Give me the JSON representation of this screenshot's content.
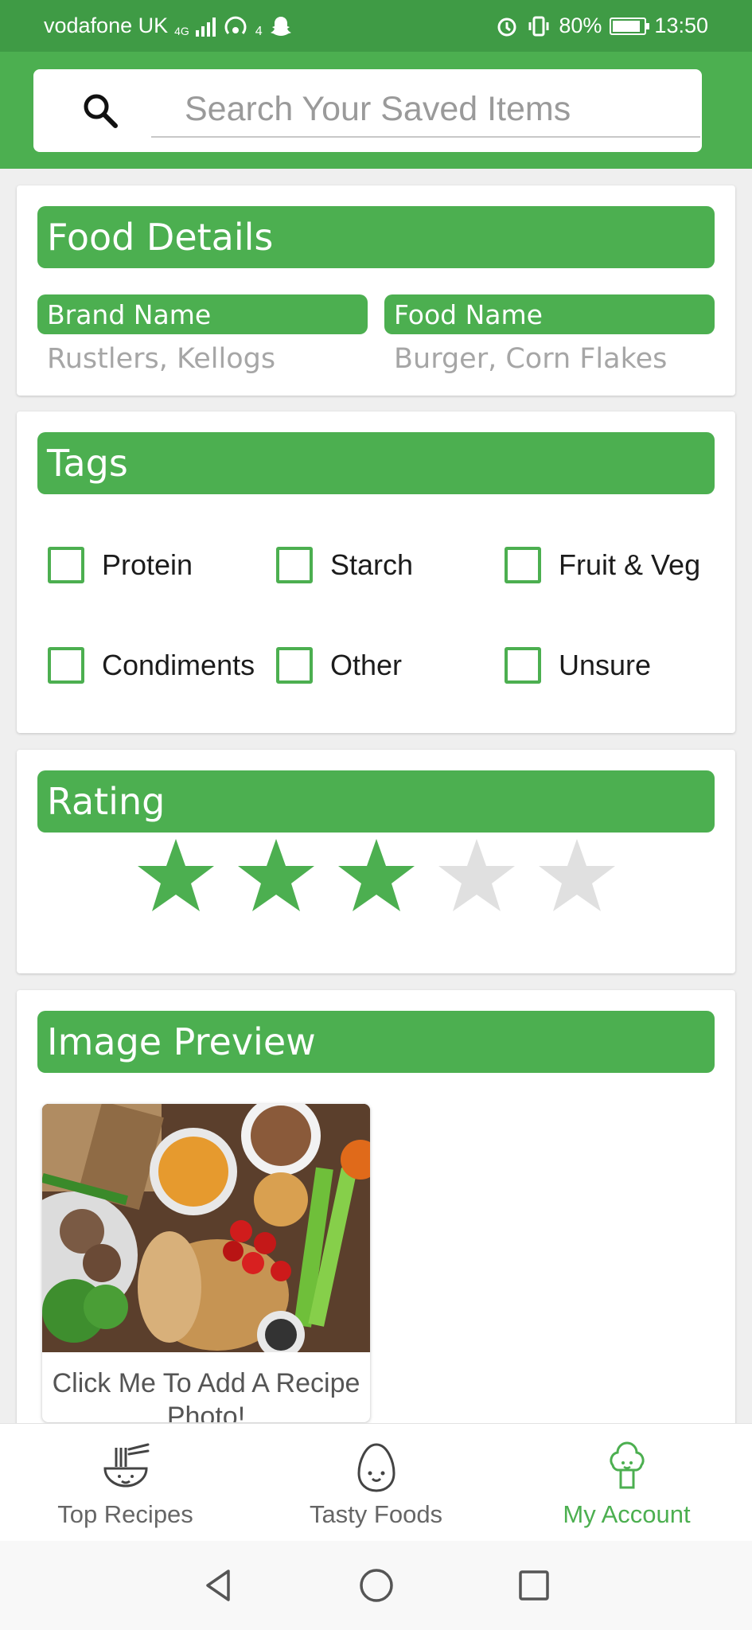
{
  "status_bar": {
    "carrier": "vodafone UK",
    "network": "4G",
    "hotspot_badge": "4",
    "battery": "80%",
    "time": "13:50"
  },
  "search": {
    "placeholder": "Search Your Saved Items"
  },
  "food_details": {
    "title": "Food Details",
    "brand_label": "Brand Name",
    "brand_placeholder": "Rustlers, Kellogs",
    "food_label": "Food Name",
    "food_placeholder": "Burger, Corn Flakes"
  },
  "tags": {
    "title": "Tags",
    "items": [
      {
        "label": "Protein",
        "checked": false
      },
      {
        "label": "Starch",
        "checked": false
      },
      {
        "label": "Fruit & Veg",
        "checked": false
      },
      {
        "label": "Condiments",
        "checked": false
      },
      {
        "label": "Other",
        "checked": false
      },
      {
        "label": "Unsure",
        "checked": false
      }
    ]
  },
  "rating": {
    "title": "Rating",
    "value": 3,
    "max": 5
  },
  "image_preview": {
    "title": "Image Preview",
    "caption": "Click Me To Add A Recipe Photo!"
  },
  "bottom_nav": {
    "items": [
      {
        "label": "Top Recipes",
        "icon": "noodle-bowl-icon",
        "active": false
      },
      {
        "label": "Tasty Foods",
        "icon": "egg-face-icon",
        "active": false
      },
      {
        "label": "My Account",
        "icon": "broccoli-icon",
        "active": true
      }
    ]
  },
  "colors": {
    "primary": "#4caf50",
    "status_bar": "#3f9b45",
    "star_empty": "#e0e0e0"
  }
}
